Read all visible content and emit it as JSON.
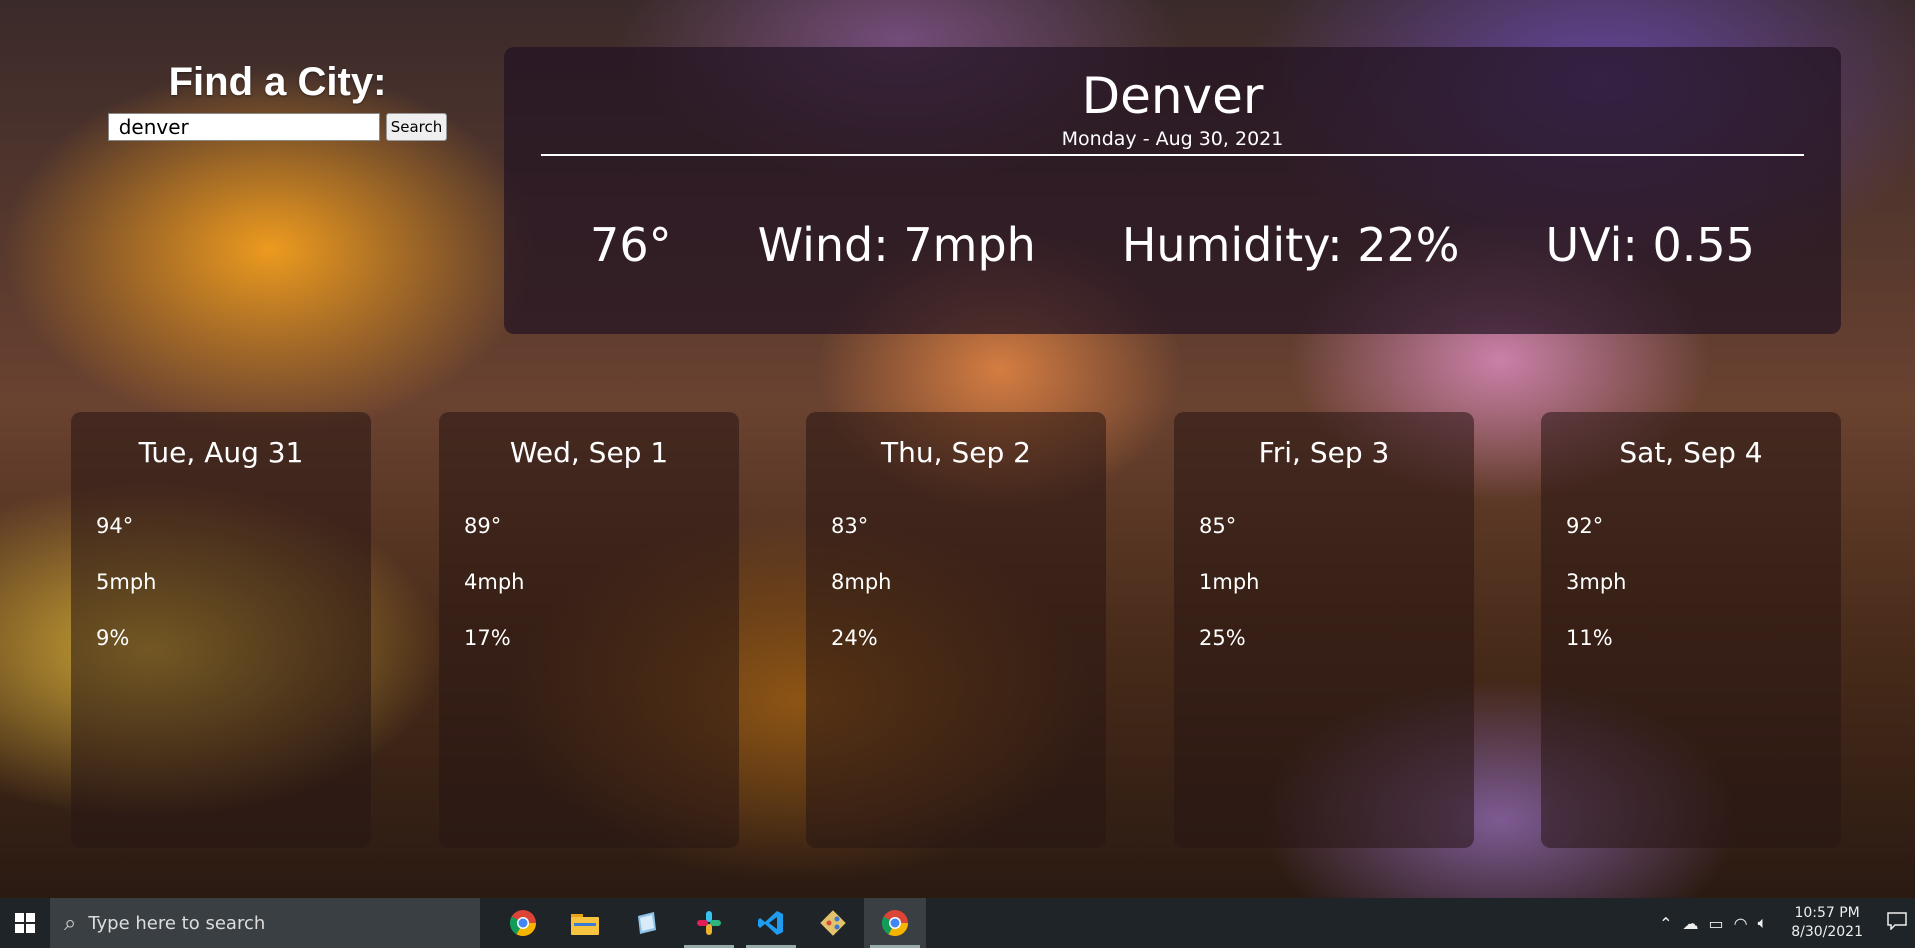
{
  "search": {
    "title": "Find a City:",
    "input_value": "denver",
    "button_label": "Search"
  },
  "current": {
    "city": "Denver",
    "date": "Monday - Aug 30, 2021",
    "temp": "76°",
    "wind": "Wind: 7mph",
    "humidity": "Humidity: 22%",
    "uvi": "UVi: 0.55"
  },
  "forecast": [
    {
      "date": "Tue, Aug 31",
      "temp": "94°",
      "wind": "5mph",
      "humidity": "9%"
    },
    {
      "date": "Wed, Sep 1",
      "temp": "89°",
      "wind": "4mph",
      "humidity": "17%"
    },
    {
      "date": "Thu, Sep 2",
      "temp": "83°",
      "wind": "8mph",
      "humidity": "24%"
    },
    {
      "date": "Fri, Sep 3",
      "temp": "85°",
      "wind": "1mph",
      "humidity": "25%"
    },
    {
      "date": "Sat, Sep 4",
      "temp": "92°",
      "wind": "3mph",
      "humidity": "11%"
    }
  ],
  "taskbar": {
    "search_placeholder": "Type here to search",
    "apps": [
      "chrome-icon",
      "file-explorer-icon",
      "notepad-icon",
      "slack-icon",
      "vscode-icon",
      "git-icon",
      "chrome-icon"
    ],
    "time": "10:57 PM",
    "date": "8/30/2021"
  },
  "colors": {
    "card_bg": "#2a1614",
    "panel_bg": "#231423",
    "taskbar_bg": "#1f2428"
  }
}
